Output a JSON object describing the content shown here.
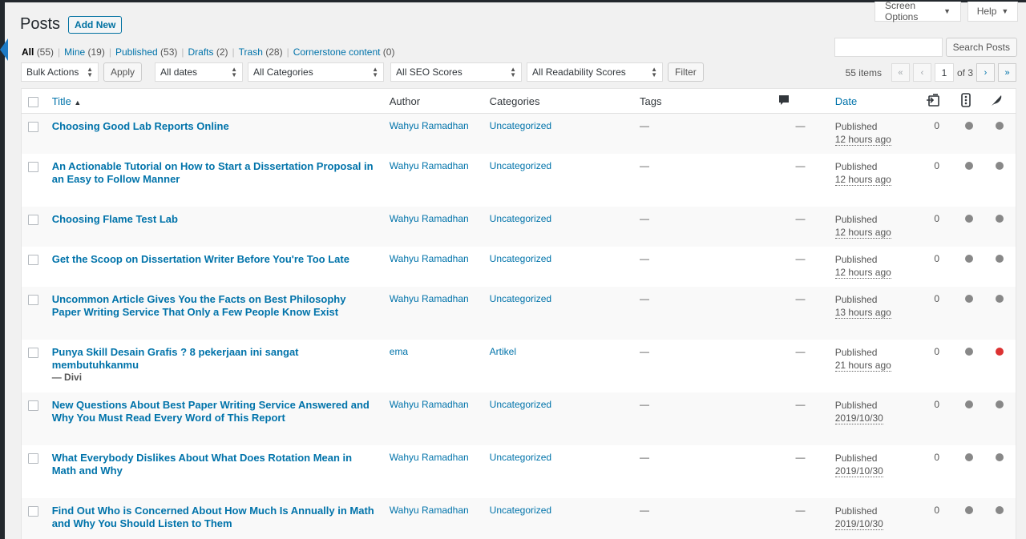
{
  "header": {
    "title": "Posts",
    "add_new": "Add New",
    "screen_options": "Screen Options",
    "help": "Help"
  },
  "views": [
    {
      "label": "All",
      "count": "(55)",
      "current": true
    },
    {
      "label": "Mine",
      "count": "(19)"
    },
    {
      "label": "Published",
      "count": "(53)"
    },
    {
      "label": "Drafts",
      "count": "(2)"
    },
    {
      "label": "Trash",
      "count": "(28)"
    },
    {
      "label": "Cornerstone content",
      "count": "(0)"
    }
  ],
  "search": {
    "placeholder": "",
    "button": "Search Posts"
  },
  "filters": {
    "bulk_actions": "Bulk Actions",
    "apply": "Apply",
    "dates": "All dates",
    "categories": "All Categories",
    "seo": "All SEO Scores",
    "readability": "All Readability Scores",
    "filter": "Filter"
  },
  "pagination": {
    "items": "55 items",
    "first": "«",
    "prev": "‹",
    "current_page": "1",
    "of": "of 3",
    "next": "›",
    "last": "»"
  },
  "columns": {
    "title": "Title",
    "sort_indicator": "▲",
    "author": "Author",
    "categories": "Categories",
    "tags": "Tags",
    "date": "Date"
  },
  "rows": [
    {
      "title": "Choosing Good Lab Reports Online",
      "author": "Wahyu Ramadhan",
      "category": "Uncategorized",
      "tags": "—",
      "comments": "—",
      "status": "Published",
      "date": "12 hours ago",
      "links": "0",
      "readability": "gray"
    },
    {
      "title": "An Actionable Tutorial on How to Start a Dissertation Proposal in an Easy to Follow Manner",
      "author": "Wahyu Ramadhan",
      "category": "Uncategorized",
      "tags": "—",
      "comments": "—",
      "status": "Published",
      "date": "12 hours ago",
      "links": "0",
      "readability": "gray"
    },
    {
      "title": "Choosing Flame Test Lab",
      "author": "Wahyu Ramadhan",
      "category": "Uncategorized",
      "tags": "—",
      "comments": "—",
      "status": "Published",
      "date": "12 hours ago",
      "links": "0",
      "readability": "gray"
    },
    {
      "title": "Get the Scoop on Dissertation Writer Before You're Too Late",
      "author": "Wahyu Ramadhan",
      "category": "Uncategorized",
      "tags": "—",
      "comments": "—",
      "status": "Published",
      "date": "12 hours ago",
      "links": "0",
      "readability": "gray"
    },
    {
      "title": "Uncommon Article Gives You the Facts on Best Philosophy Paper Writing Service That Only a Few People Know Exist",
      "author": "Wahyu Ramadhan",
      "category": "Uncategorized",
      "tags": "—",
      "comments": "—",
      "status": "Published",
      "date": "13 hours ago",
      "links": "0",
      "readability": "gray"
    },
    {
      "title": "Punya Skill Desain Grafis ? 8 pekerjaan ini sangat membutuhkanmu",
      "suffix": "— Divi",
      "author": "ema",
      "category": "Artikel",
      "tags": "—",
      "comments": "—",
      "status": "Published",
      "date": "21 hours ago",
      "links": "0",
      "readability": "red"
    },
    {
      "title": "New Questions About Best Paper Writing Service Answered and Why You Must Read Every Word of This Report",
      "author": "Wahyu Ramadhan",
      "category": "Uncategorized",
      "tags": "—",
      "comments": "—",
      "status": "Published",
      "date": "2019/10/30",
      "links": "0",
      "readability": "gray"
    },
    {
      "title": "What Everybody Dislikes About What Does Rotation Mean in Math and Why",
      "author": "Wahyu Ramadhan",
      "category": "Uncategorized",
      "tags": "—",
      "comments": "—",
      "status": "Published",
      "date": "2019/10/30",
      "links": "0",
      "readability": "gray"
    },
    {
      "title": "Find Out Who is Concerned About How Much Is Annually in Math and Why You Should Listen to Them",
      "author": "Wahyu Ramadhan",
      "category": "Uncategorized",
      "tags": "—",
      "comments": "—",
      "status": "Published",
      "date": "2019/10/30",
      "links": "0",
      "readability": "gray"
    }
  ],
  "colors": {
    "link": "#0073aa",
    "dot_gray": "#888888",
    "dot_red": "#dc3232"
  }
}
